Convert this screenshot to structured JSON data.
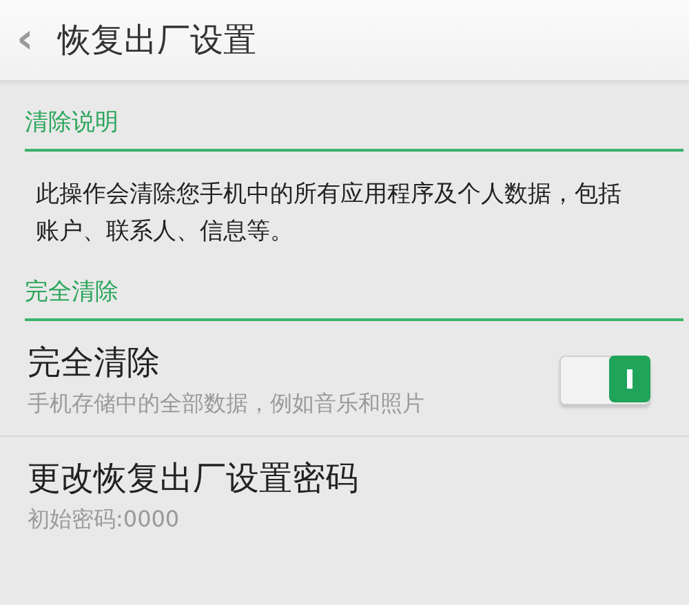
{
  "header": {
    "back": "‹",
    "title": "恢复出厂设置"
  },
  "sections": [
    {
      "title": "清除说明",
      "items": [
        {
          "kind": "text",
          "text": "此操作会清除您手机中的所有应用程序及个人数据，包括账户、联系人、信息等。"
        }
      ]
    },
    {
      "title": "完全清除",
      "items": [
        {
          "kind": "toggle",
          "title": "完全清除",
          "subtitle": "手机存储中的全部数据，例如音乐和照片",
          "on": true
        },
        {
          "kind": "link",
          "title": "更改恢复出厂设置密码",
          "subtitle": "初始密码:0000"
        }
      ]
    }
  ]
}
